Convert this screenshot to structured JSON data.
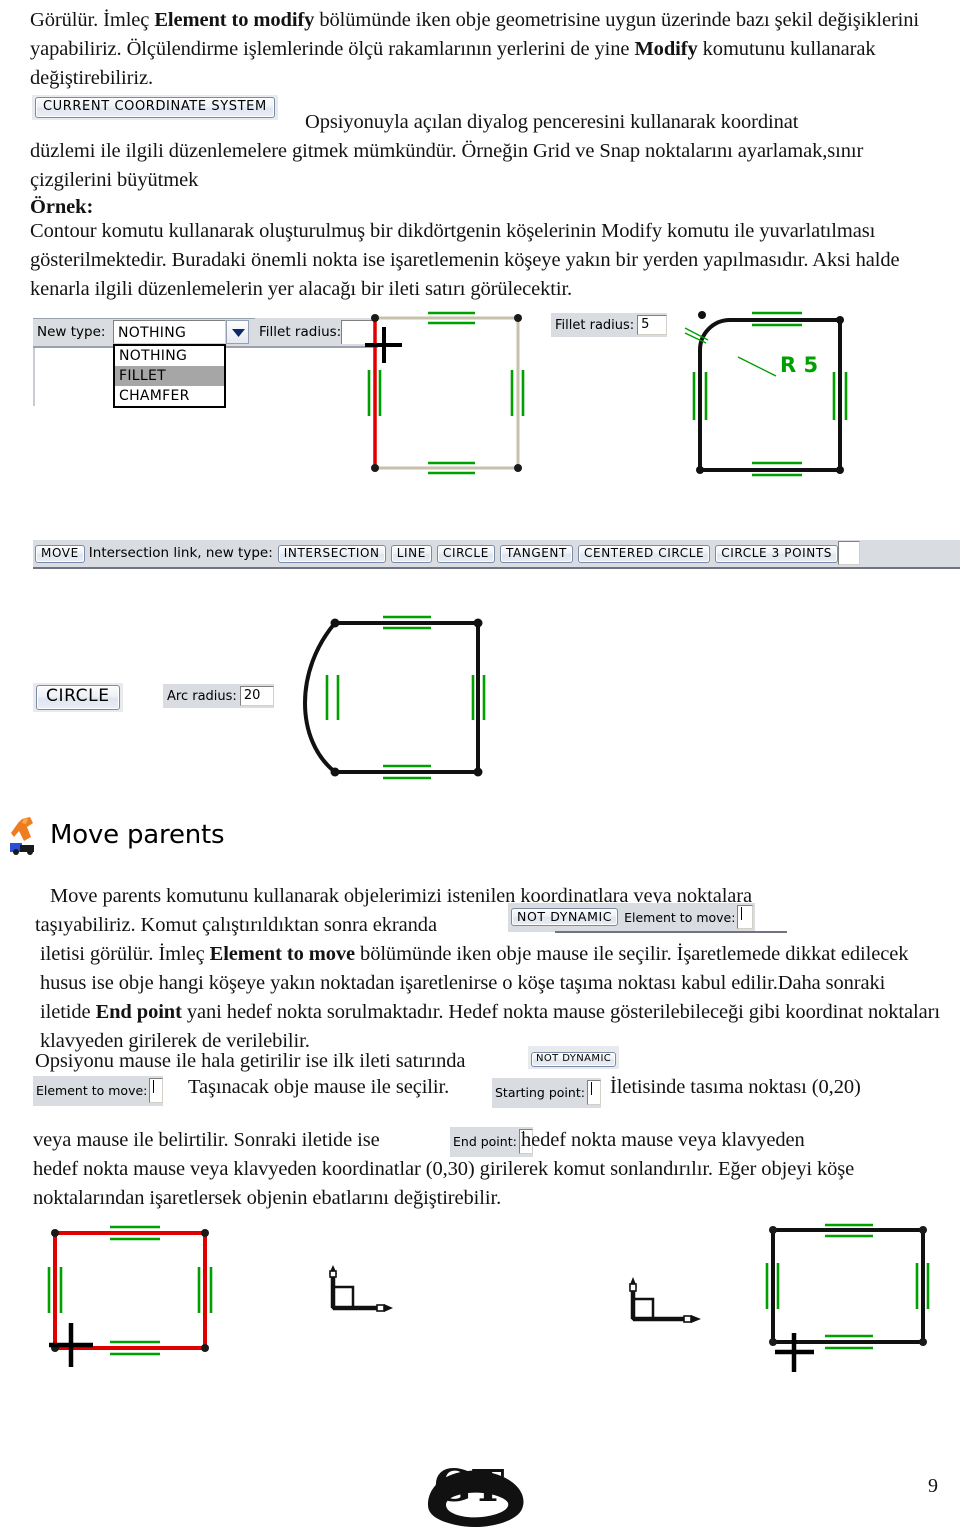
{
  "document": {
    "page_number": "9",
    "logo_text": "GT"
  },
  "paragraphs": {
    "p1": {
      "seg1": "Görülür. İmleç ",
      "bold1": "Element to modify",
      "seg2": " bölümünde iken obje geometrisine uygun üzerinde bazı şekil değişiklerini yapabiliriz. Ölçülendirme işlemlerinde ölçü rakamlarının yerlerini de yine ",
      "bold2": "Modify",
      "seg3": " komutunu kullanarak değiştirebiliriz."
    },
    "p2": {
      "seg1": "Opsiyonuyla açılan diyalog penceresini kullanarak koordinat düzlemi ile ilgili düzenlemelere gitmek mümkündür. Örneğin Grid ve Snap noktalarını ayarlamak,sınır çizgilerini büyütmek",
      "bold_header": "Örnek:",
      "seg2": "Contour komutu kullanarak oluşturulmuş bir dikdörtgenin köşelerinin Modify komutu ile yuvarlatılması gösterilmektedir. Buradaki önemli nokta ise işaretlemenin köşeye yakın bir yerden yapılmasıdır. Aksi halde kenarla ilgili düzenlemelerin yer alacağı bir ileti satırı görülecektir."
    },
    "p3": {
      "seg1": "Move parents komutunu kullanarak objelerimizi istenilen koordinatlara veya noktalara taşıyabiliriz. Komut çalıştırıldıktan sonra ekranda",
      "seg2": "iletisi görülür. İmleç ",
      "bold1": "Element to move",
      "seg3": " bölümünde iken obje mause ile seçilir. İşaretlemede dikkat edilecek husus ise obje hangi köşeye yakın noktadan işaretlenirse o köşe taşıma noktası kabul edilir.Daha sonraki iletide ",
      "bold2": "End point",
      "seg4": " yani hedef nokta sorulmaktadır. Hedef nokta mause gösterilebileceği gibi koordinat noktaları klavyeden girilerek de verilebilir.",
      "seg5": "Opsiyonu mause ile hala getirilir ise ilk ileti satırında",
      "seg6": "Taşınacak obje mause ile seçilir.",
      "seg7": "İletisinde tasıma noktası (0,20)"
    },
    "p4": {
      "seg1": "veya mause ile belirtilir. Sonraki iletide ise",
      "seg2": "hedef nokta mause veya klavyeden koordinatlar (0,30) girilerek komut sonlandırılır. Eğer objeyi köşe noktalarından işaretlersek objenin ebatlarını değiştirebilir."
    }
  },
  "widgets": {
    "current_coordinate_system": {
      "label": "CURRENT COORDINATE SYSTEM"
    },
    "new_type": {
      "label": "New type:",
      "selected": "NOTHING",
      "options": [
        "NOTHING",
        "FILLET",
        "CHAMFER"
      ],
      "highlighted": "FILLET",
      "chevron_icon": "chevron-down-icon"
    },
    "fillet_radius_empty": {
      "label": "Fillet radius:",
      "value": ""
    },
    "fillet_radius_set": {
      "label": "Fillet radius:",
      "value": "5"
    },
    "move_toolbar": {
      "move_button": "MOVE",
      "prompt": "Intersection link, new type:",
      "buttons": [
        "INTERSECTION",
        "LINE",
        "CIRCLE",
        "TANGENT",
        "CENTERED CIRCLE",
        "CIRCLE 3 POINTS"
      ],
      "input_value": ""
    },
    "circle_row": {
      "circle_button": "CIRCLE",
      "arc_radius_label": "Arc radius:",
      "arc_radius_value": "20"
    },
    "move_parents_heading": {
      "label": "Move parents",
      "icon": "move-parents-icon"
    },
    "not_dynamic_1": {
      "button": "NOT DYNAMIC",
      "label": "Element to move:",
      "value": ""
    },
    "not_dynamic_2": {
      "button": "NOT DYNAMIC"
    },
    "element_to_move": {
      "label": "Element to move:",
      "value": ""
    },
    "starting_point": {
      "label": "Starting point:",
      "value": ""
    },
    "end_point": {
      "label": "End point:",
      "value": ""
    }
  },
  "drawings": {
    "rect_contour": {
      "annotation_color": "#00a000",
      "selected_edge_color": "#e00000",
      "edge_color": "#c8c0ac"
    },
    "rect_filleted": {
      "radius_label": "R 5",
      "label_color": "#00a000"
    },
    "arc_shape": {
      "note": "rectangle with left edge replaced by arc"
    },
    "rect_moved_red": {
      "edge_color": "#e00000"
    },
    "rect_moved_black": {
      "edge_color": "#000000"
    }
  }
}
